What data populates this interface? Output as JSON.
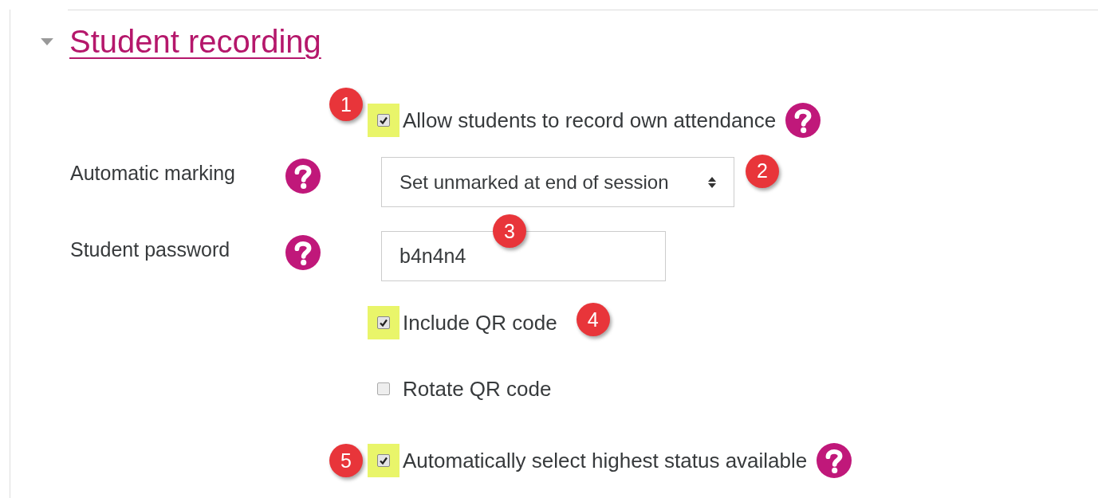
{
  "section": {
    "title": "Student recording",
    "expanded": true
  },
  "rows": [
    {
      "kind": "checkbox",
      "label": "Allow students to record own attendance",
      "checked": true,
      "highlighted": true,
      "help": true,
      "badge": "1"
    },
    {
      "kind": "select",
      "label": "Automatic marking",
      "help": true,
      "value": "Set unmarked at end of session",
      "badge": "2"
    },
    {
      "kind": "text",
      "label": "Student password",
      "help": true,
      "value": "b4n4n4",
      "badge": "3"
    },
    {
      "kind": "checkbox",
      "label": "Include QR code",
      "checked": true,
      "highlighted": true,
      "help": false,
      "badge": "4"
    },
    {
      "kind": "checkbox",
      "label": "Rotate QR code",
      "checked": false,
      "highlighted": false,
      "help": false
    },
    {
      "kind": "checkbox",
      "label": "Automatically select highest status available",
      "checked": true,
      "highlighted": true,
      "help": true,
      "badge": "5"
    }
  ]
}
